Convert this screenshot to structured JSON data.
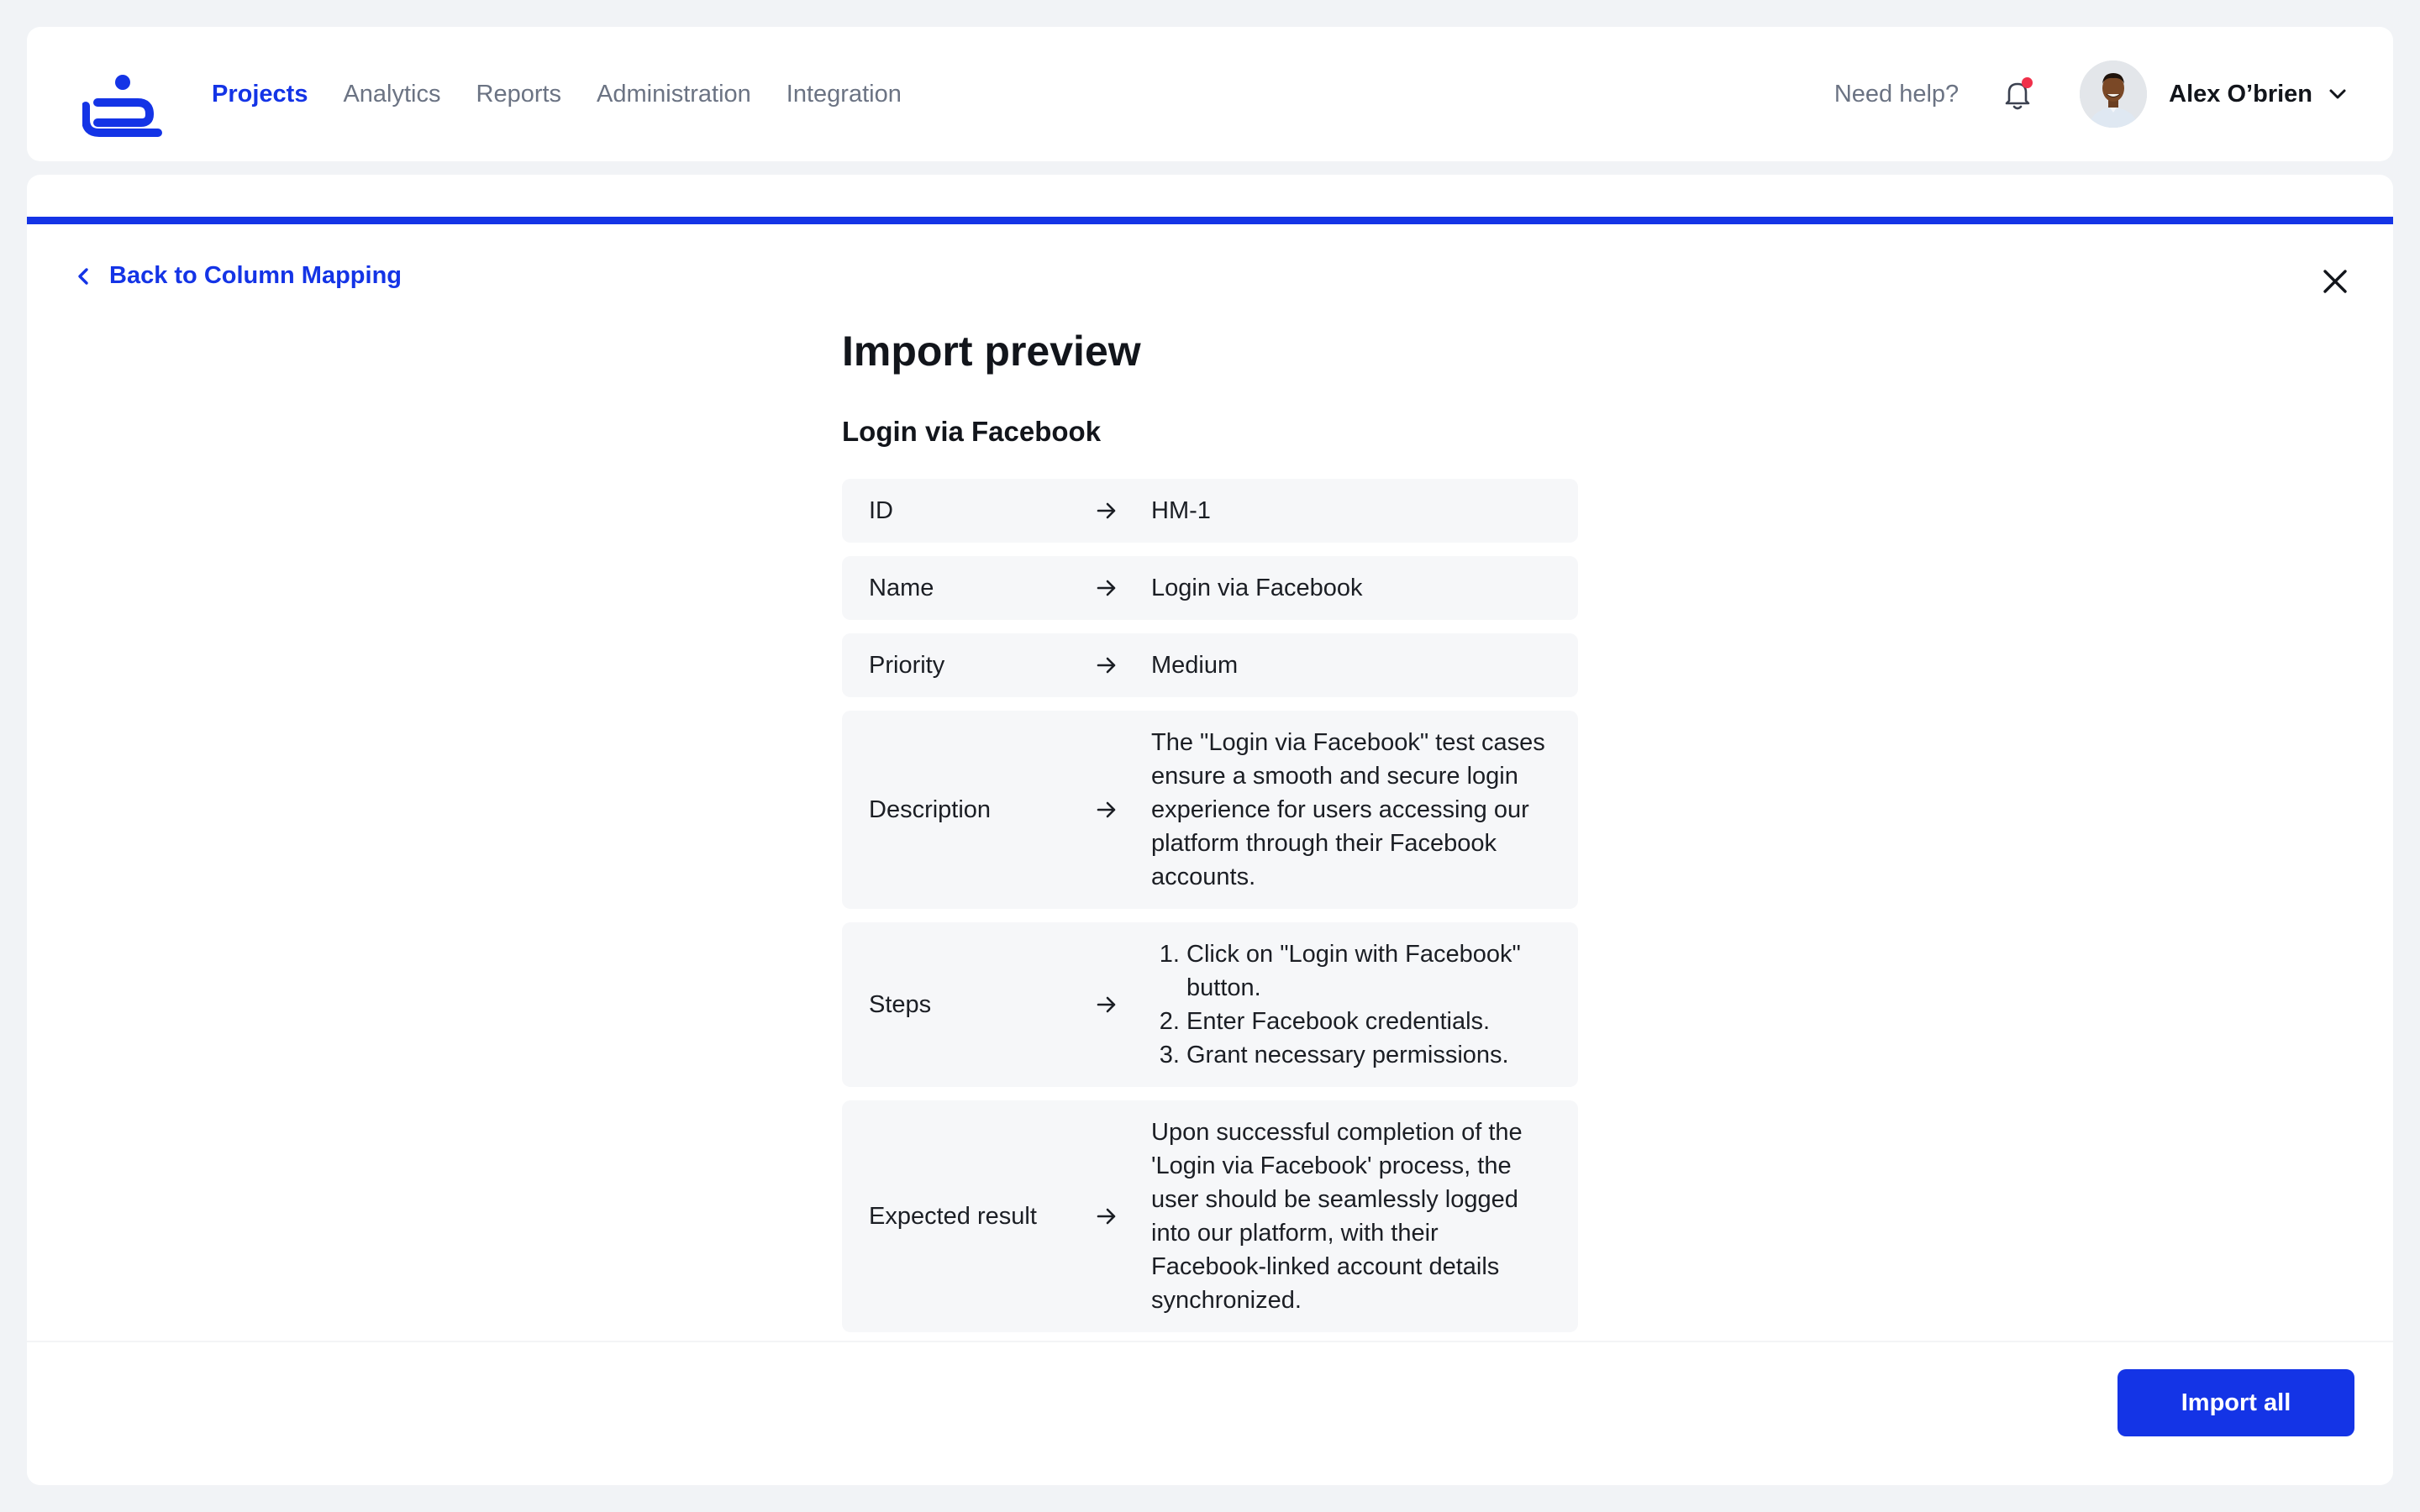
{
  "header": {
    "logo_icon": "app-logo-icon",
    "nav": [
      {
        "label": "Projects",
        "active": true
      },
      {
        "label": "Analytics",
        "active": false
      },
      {
        "label": "Reports",
        "active": false
      },
      {
        "label": "Administration",
        "active": false
      },
      {
        "label": "Integration",
        "active": false
      }
    ],
    "help_label": "Need help?",
    "notifications_icon": "bell-icon",
    "has_unread": true,
    "user": {
      "name": "Alex O’brien",
      "avatar_icon": "avatar",
      "dropdown_icon": "chevron-down-icon"
    }
  },
  "progress": {
    "fraction": 1.0,
    "color": "#1434e6"
  },
  "back_link": {
    "label": "Back to Column Mapping",
    "icon": "chevron-left-icon"
  },
  "close_icon": "close-icon",
  "page": {
    "title": "Import preview",
    "case_title": "Login via Facebook"
  },
  "mapping": {
    "arrow_icon": "arrow-right-icon",
    "rows": [
      {
        "field": "ID",
        "value": "HM-1"
      },
      {
        "field": "Name",
        "value": "Login via Facebook"
      },
      {
        "field": "Priority",
        "value": "Medium"
      },
      {
        "field": "Description",
        "value": "The \"Login via Facebook\" test cases ensure a smooth and secure login experience for users accessing our platform through their Facebook accounts."
      },
      {
        "field": "Steps",
        "steps": [
          "Click on \"Login with Facebook\" button.",
          "Enter Facebook credentials.",
          "Grant necessary permissions."
        ]
      },
      {
        "field": "Expected result",
        "value": "Upon successful completion of the 'Login via Facebook' process, the user should be seamlessly logged into our platform, with their Facebook-linked account details synchronized."
      }
    ]
  },
  "footer": {
    "import_button_label": "Import all"
  },
  "colors": {
    "accent": "#1434e6",
    "notification_dot": "#f0304a",
    "row_bg": "#f6f7f9",
    "page_bg": "#f1f3f6"
  }
}
